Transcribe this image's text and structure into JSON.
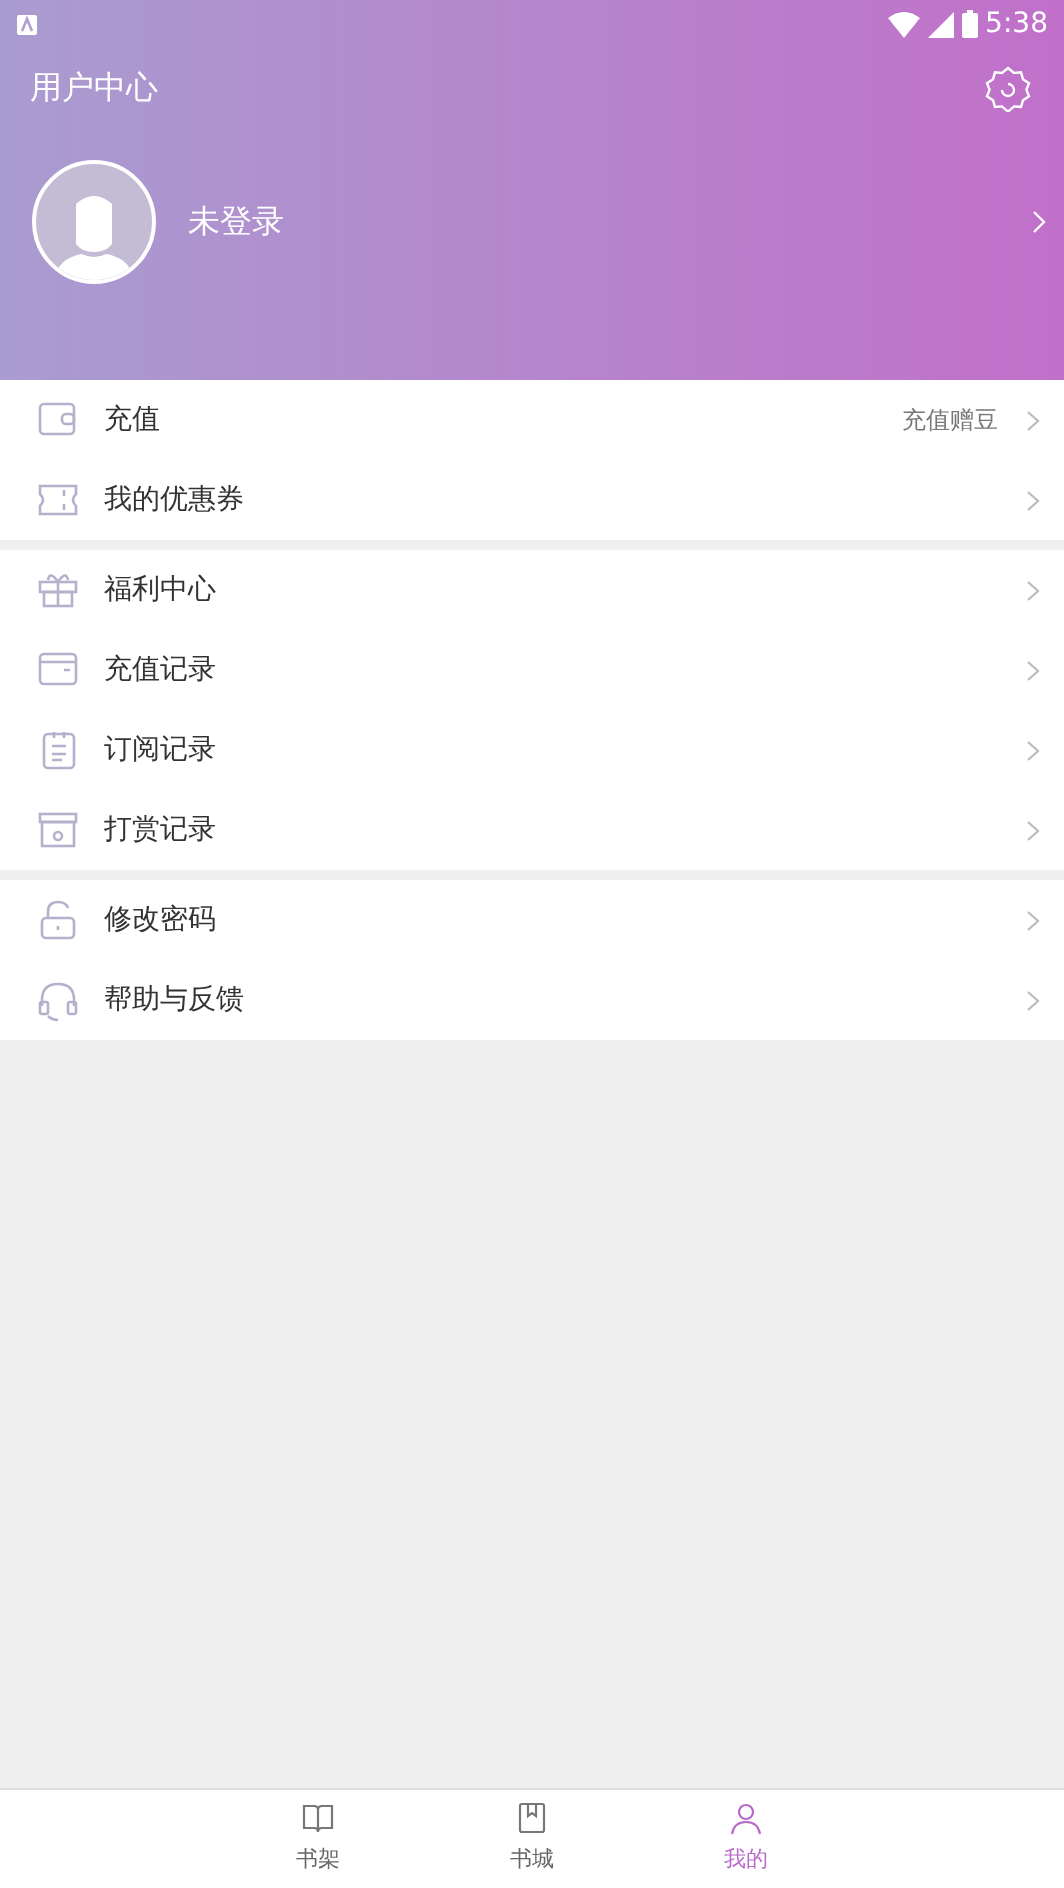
{
  "status_bar": {
    "time": "5:38"
  },
  "header": {
    "title": "用户中心",
    "user": {
      "name": "未登录"
    }
  },
  "sections": [
    {
      "items": [
        {
          "label": "充值",
          "note": "充值赠豆"
        },
        {
          "label": "我的优惠券"
        }
      ]
    },
    {
      "items": [
        {
          "label": "福利中心"
        },
        {
          "label": "充值记录"
        },
        {
          "label": "订阅记录"
        },
        {
          "label": "打赏记录"
        }
      ]
    },
    {
      "items": [
        {
          "label": "修改密码"
        },
        {
          "label": "帮助与反馈"
        }
      ]
    }
  ],
  "tab_bar": [
    {
      "label": "书架",
      "selected": false
    },
    {
      "label": "书城",
      "selected": false
    },
    {
      "label": "我的",
      "selected": true
    }
  ]
}
